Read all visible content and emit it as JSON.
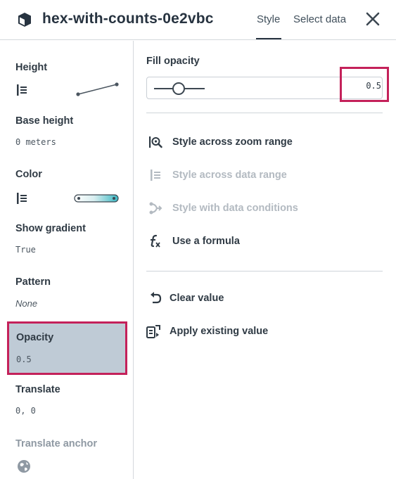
{
  "header": {
    "title": "hex-with-counts-0e2vbc",
    "tabs": [
      {
        "label": "Style",
        "active": true
      },
      {
        "label": "Select data",
        "active": false
      }
    ],
    "icons": {
      "layer": "layer-cube-icon",
      "close": "close-icon"
    }
  },
  "sidebar": {
    "properties": [
      {
        "label": "Height",
        "icon": "data-list-icon",
        "preview": "line-preview"
      },
      {
        "label": "Base height",
        "value": "0 meters"
      },
      {
        "label": "Color",
        "icon": "data-list-icon",
        "preview": "gradient-bar"
      },
      {
        "label": "Show gradient",
        "value": "True"
      },
      {
        "label": "Pattern",
        "value": "None"
      },
      {
        "label": "Opacity",
        "value": "0.5",
        "selected": true
      },
      {
        "label": "Translate",
        "value": "0, 0"
      },
      {
        "label": "Translate anchor",
        "icon": "globe-icon",
        "muted": true
      }
    ]
  },
  "main": {
    "fill_opacity_label": "Fill opacity",
    "slider_value": 0.5,
    "value_display": "0.5",
    "style_options": [
      {
        "label": "Style across zoom range",
        "icon": "zoom-range-icon",
        "enabled": true
      },
      {
        "label": "Style across data range",
        "icon": "data-range-icon",
        "enabled": false
      },
      {
        "label": "Style with data conditions",
        "icon": "data-conditions-icon",
        "enabled": false
      },
      {
        "label": "Use a formula",
        "icon": "formula-icon",
        "enabled": true
      }
    ],
    "value_actions": [
      {
        "label": "Clear value",
        "icon": "undo-icon"
      },
      {
        "label": "Apply existing value",
        "icon": "apply-value-icon"
      }
    ]
  },
  "colors": {
    "accent_highlight": "#c4215a",
    "selected_bg": "#bfcbd6",
    "text": "#2f3a44",
    "gradient_end": "#3bb8c3"
  }
}
